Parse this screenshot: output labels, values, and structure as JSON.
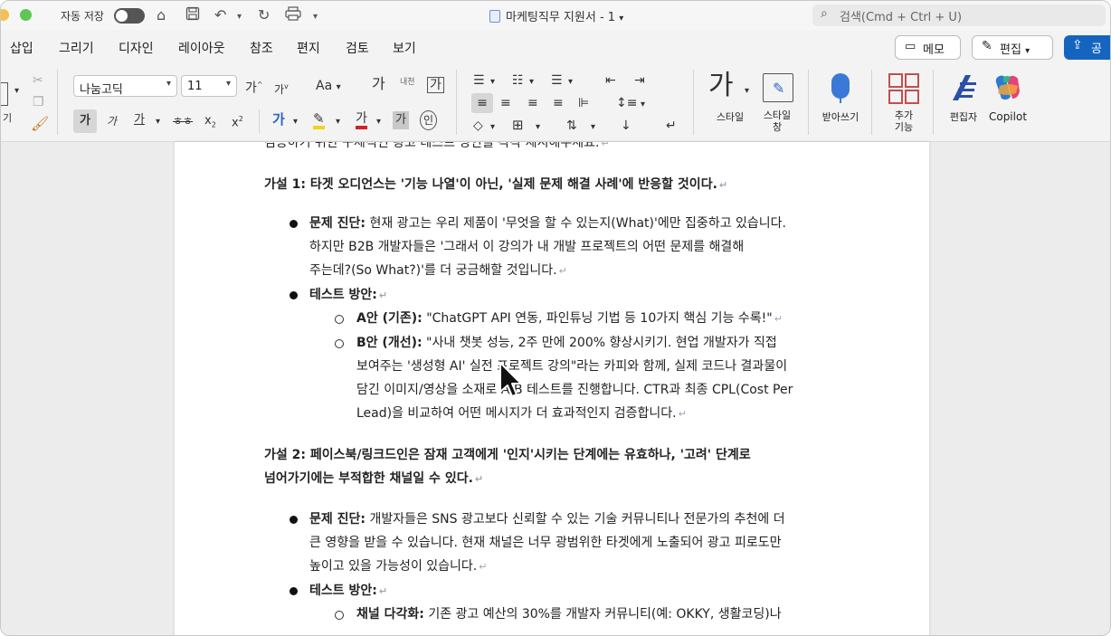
{
  "titlebar": {
    "autosave_label": "자동 저장",
    "doc_title": "마케팅직무 지원서 - 1",
    "search_placeholder": "검색(Cmd + Ctrl + U)"
  },
  "tabs": [
    "삽입",
    "그리기",
    "디자인",
    "레이아웃",
    "참조",
    "편지",
    "검토",
    "보기"
  ],
  "actions": {
    "memo": "메모",
    "edit": "편집",
    "share": "공"
  },
  "ribbon": {
    "paste_label": "기",
    "font_name": "나눔고딕",
    "font_size": "11",
    "grow": "가",
    "shrink": "가",
    "case": "Aa",
    "bold": "가",
    "italic": "가",
    "underline": "가",
    "strike": "ㅎㅎ",
    "sub": "x",
    "sup": "x",
    "phonetic": "내천",
    "border_char": "가",
    "style_label": "스타일",
    "style_pane_label1": "스타일",
    "style_pane_label2": "창",
    "dictate_label": "받아쓰기",
    "addins_label1": "추가",
    "addins_label2": "기능",
    "editor_label": "편집자",
    "copilot_label": "Copilot"
  },
  "document": {
    "top_cut": "검증하기 위한 구체적인 광고 테스트 방안을 각각 제시해주세요.",
    "h1": "가설 1: 타겟 오디언스는 '기능 나열'이 아닌, '실제 문제 해결 사례'에 반응할 것이다.",
    "h1_diag_label": "문제 진단:",
    "h1_diag_1": " 현재 광고는 우리 제품이 '무엇을 할 수 있는지(What)'에만 집중하고 있습니다.",
    "h1_diag_2": "하지만 B2B 개발자들은 '그래서 이 강의가 내 개발 프로젝트의 어떤 문제를 해결해",
    "h1_diag_3": "주는데?(So What?)'를 더 궁금해할 것입니다.",
    "test_label": "테스트 방안:",
    "a_label": "A안 (기존):",
    "a_text": " \"ChatGPT API 연동, 파인튜닝 기법 등 10가지 핵심 기능 수록!\"",
    "b_label": "B안 (개선):",
    "b_text_1": " \"사내 챗봇 성능, 2주 만에 200% 향상시키기. 현업 개발자가 직접",
    "b_text_2": "보여주는 '생성형 AI' 실전 프로젝트 강의\"라는 카피와 함께, 실제 코드나 결과물이",
    "b_text_3": "담긴 이미지/영상을 소재로 A/B 테스트를 진행합니다. CTR과 최종 CPL(Cost Per",
    "b_text_4": "Lead)을 비교하여 어떤 메시지가 더 효과적인지 검증합니다.",
    "h2_1": "가설 2: 페이스북/링크드인은 잠재 고객에게 '인지'시키는 단계에는 유효하나, '고려' 단계로",
    "h2_2": "넘어가기에는 부적합한 채널일 수 있다.",
    "h2_diag_label": "문제 진단:",
    "h2_diag_1": " 개발자들은 SNS 광고보다 신뢰할 수 있는 기술 커뮤니티나 전문가의 추천에 더",
    "h2_diag_2": "큰 영향을 받을 수 있습니다. 현재 채널은 너무 광범위한 타겟에게 노출되어 광고 피로도만",
    "h2_diag_3": "높이고 있을 가능성이 있습니다.",
    "test2_label": "테스트 방안:",
    "c_label": "채널 다각화:",
    "c_text": " 기존 광고 예산의 30%를 개발자 커뮤니티(예: OKKY, 생활코딩)나"
  }
}
